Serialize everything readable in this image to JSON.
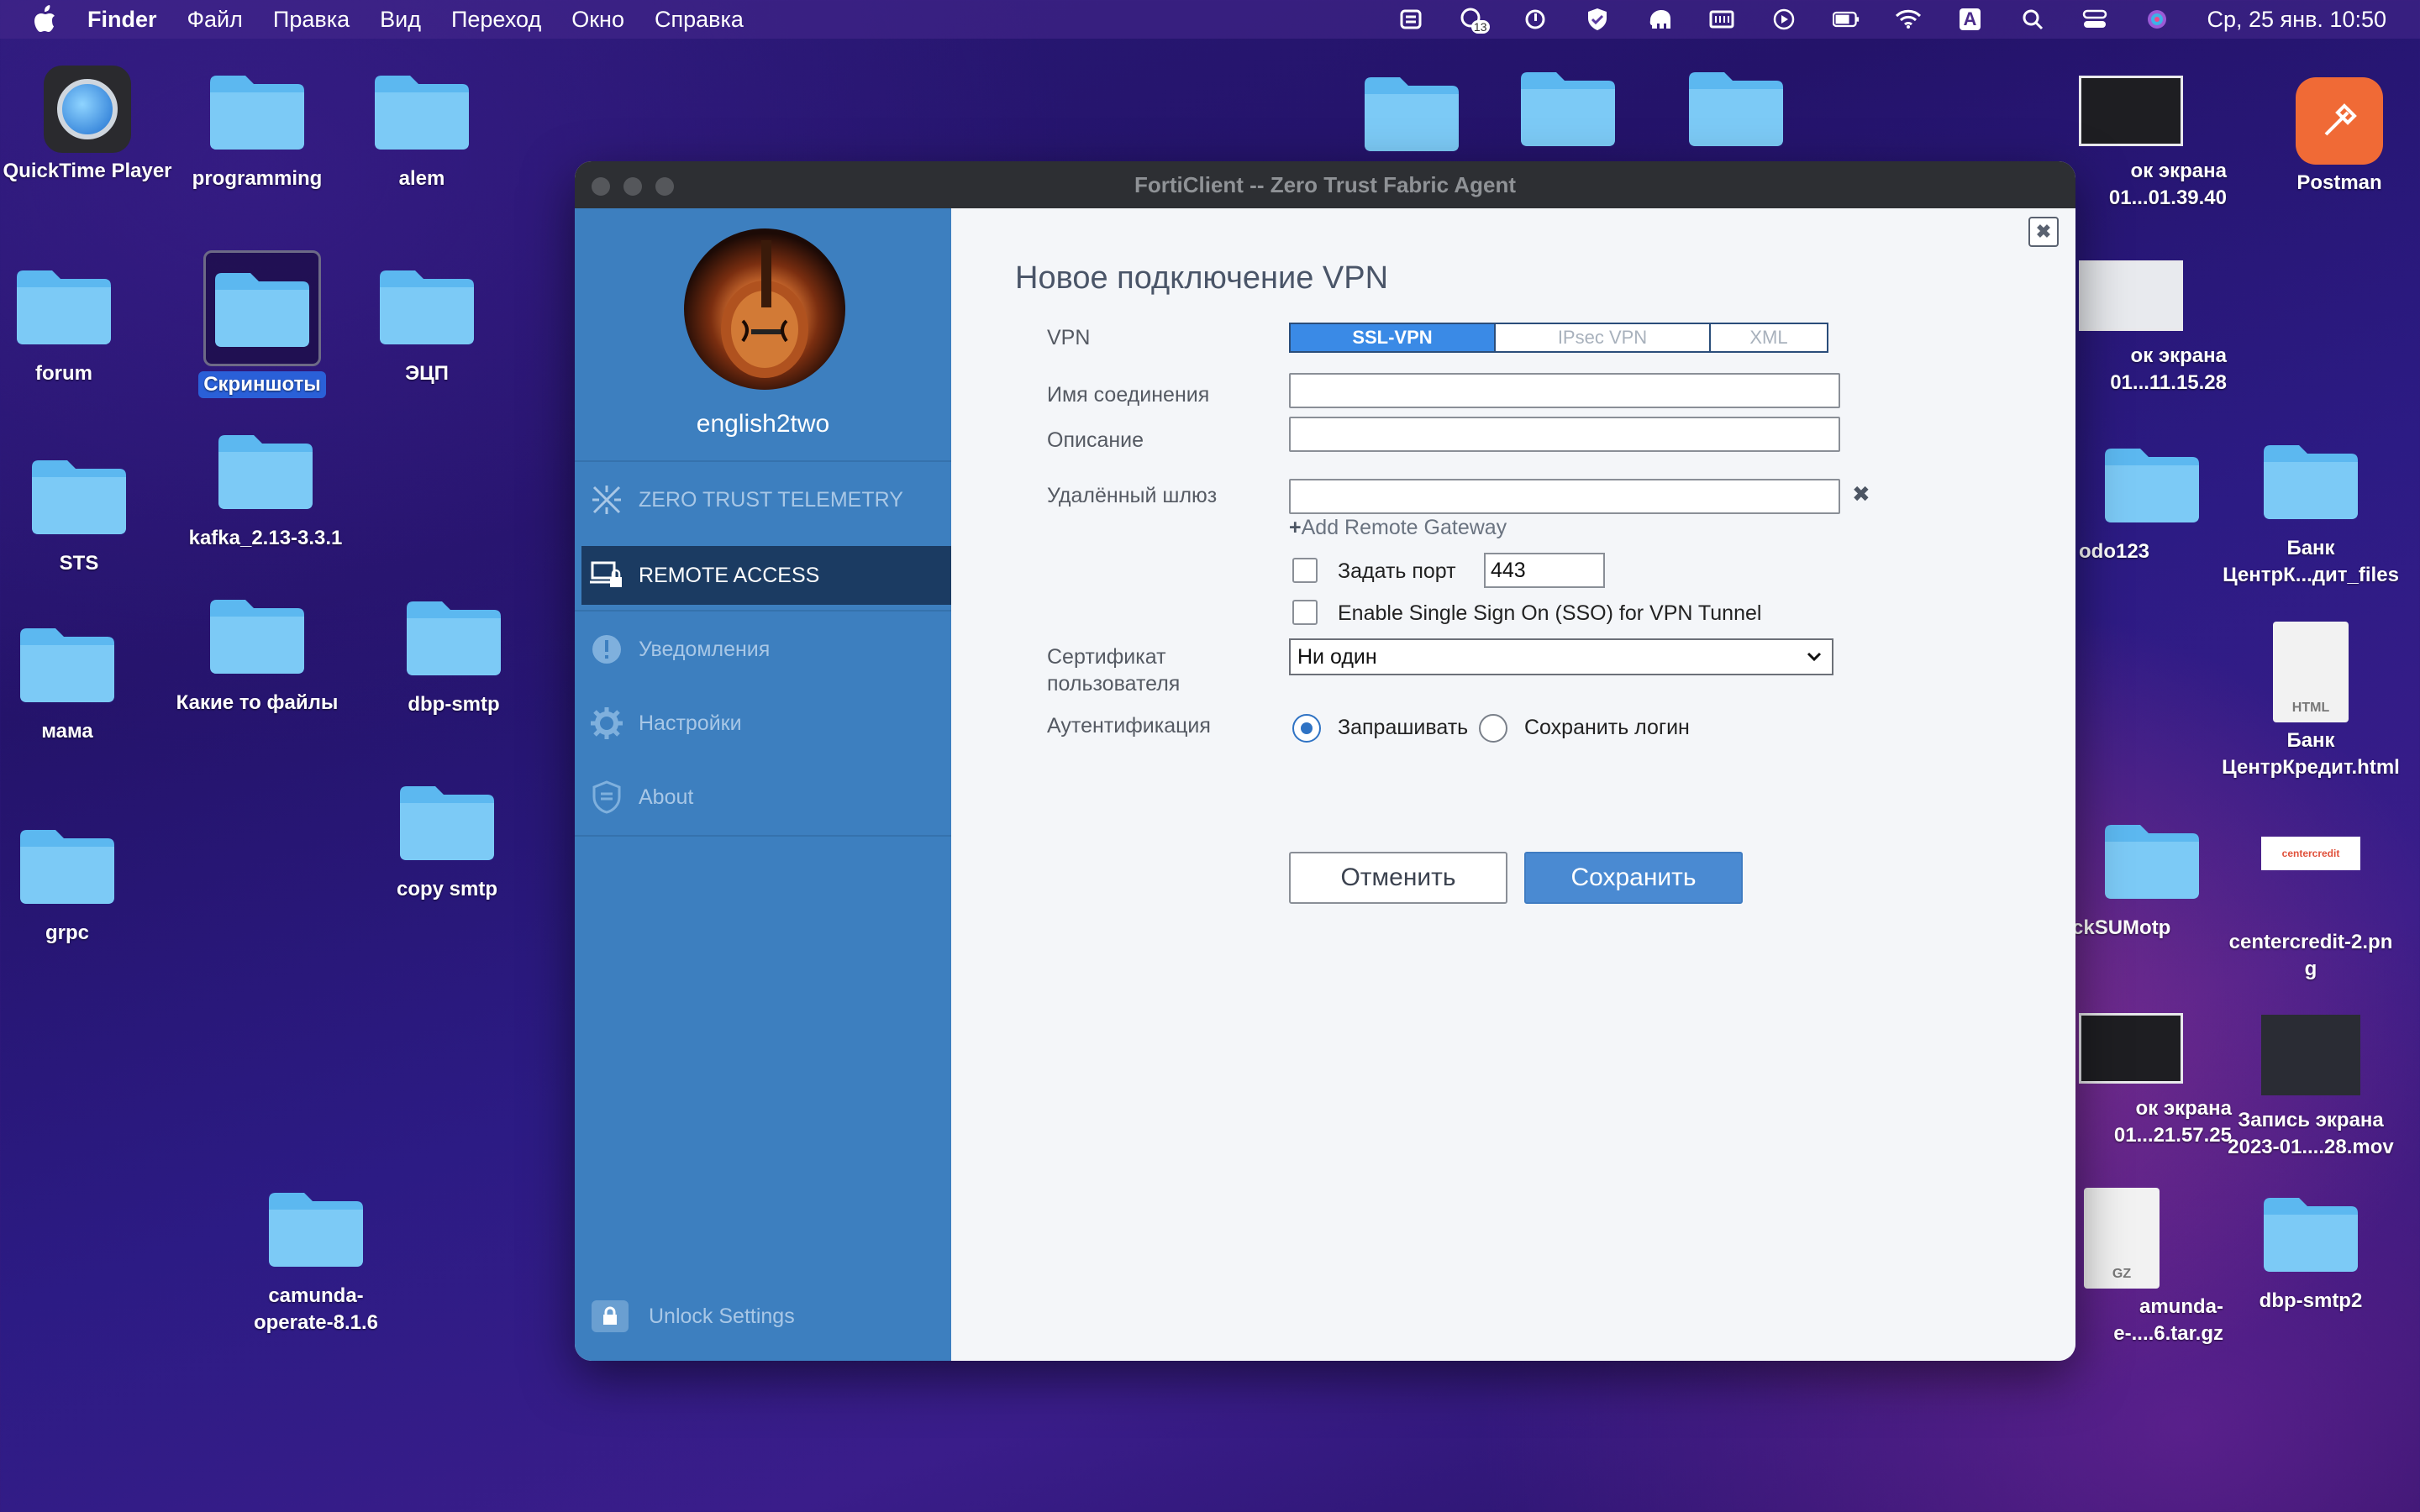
{
  "menubar": {
    "app": "Finder",
    "items": [
      "Файл",
      "Правка",
      "Вид",
      "Переход",
      "Окно",
      "Справка"
    ],
    "clock": "Ср, 25 янв.  10:50",
    "badge_13": "13",
    "input_source": "A"
  },
  "desktop": {
    "icons": [
      {
        "label": "QuickTime Player"
      },
      {
        "label": "programming"
      },
      {
        "label": "alem"
      },
      {
        "label": "forum"
      },
      {
        "label": "Скриншоты"
      },
      {
        "label": "ЭЦП"
      },
      {
        "label": "STS"
      },
      {
        "label": "kafka_2.13-3.3.1"
      },
      {
        "label": "мама"
      },
      {
        "label": "Какие то файлы"
      },
      {
        "label": "dbp-smtp"
      },
      {
        "label": "copy smtp"
      },
      {
        "label": "grpc"
      },
      {
        "label": "camunda-\noperate-8.1.6"
      },
      {
        "label": "Postman"
      },
      {
        "label": "ок экрана\n01...01.39.40"
      },
      {
        "label": "ок экрана\n01...11.15.28"
      },
      {
        "label": "odo123"
      },
      {
        "label": "Банк\nЦентрК...дит_files"
      },
      {
        "label": "Банк\nЦентрКредит.html"
      },
      {
        "label": "ckSUMotp"
      },
      {
        "label": "centercredit-2.pn\ng"
      },
      {
        "label": "ок экрана\n01...21.57.25"
      },
      {
        "label": "Запись экрана\n2023-01....28.mov"
      },
      {
        "label": "amunda-\ne-....6.tar.gz"
      },
      {
        "label": "dbp-smtp2"
      }
    ],
    "doc_tags": {
      "html": "HTML",
      "gz": "GZ",
      "centercredit": "centercredit"
    }
  },
  "window": {
    "title": "FortiClient -- Zero Trust Fabric Agent",
    "sidebar": {
      "username": "english2two",
      "nav": [
        {
          "label": "ZERO TRUST TELEMETRY",
          "icon": "telemetry-icon"
        },
        {
          "label": "REMOTE ACCESS",
          "icon": "remote-access-icon"
        },
        {
          "label": "Уведомления",
          "icon": "notification-icon"
        },
        {
          "label": "Настройки",
          "icon": "settings-icon"
        },
        {
          "label": "About",
          "icon": "about-icon"
        }
      ],
      "unlock": "Unlock Settings"
    },
    "form": {
      "close": "✖",
      "title": "Новое подключение VPN",
      "vpn_label": "VPN",
      "tabs": [
        "SSL-VPN",
        "IPsec VPN",
        "XML"
      ],
      "connection_name_label": "Имя соединения",
      "connection_name_value": "",
      "description_label": "Описание",
      "description_value": "",
      "gateway_label": "Удалённый шлюз",
      "gateway_value": "",
      "add_gateway": "Add Remote Gateway",
      "set_port_label": "Задать порт",
      "port_value": "443",
      "sso_label": "Enable Single Sign On (SSO) for VPN Tunnel",
      "cert_label_1": "Сертификат",
      "cert_label_2": "пользователя",
      "cert_value": "Ни один",
      "auth_label": "Аутентификация",
      "auth_options": [
        "Запрашивать",
        "Сохранить логин"
      ],
      "cancel": "Отменить",
      "save": "Сохранить"
    }
  },
  "colors": {
    "sidebar": "#3d7fbf",
    "active_nav": "#1b3b62",
    "accent": "#3a8ae6",
    "folder": "#5cb8f0"
  }
}
